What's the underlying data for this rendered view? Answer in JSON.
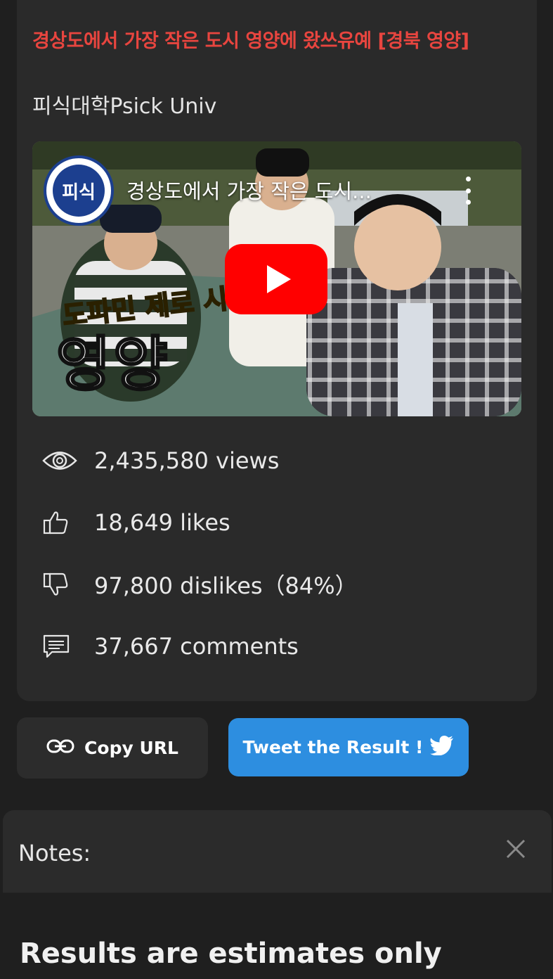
{
  "video": {
    "title": "경상도에서 가장 작은 도시 영양에 왔쓰유예 [경북 영양]",
    "channel": "피식대학Psick Univ",
    "thumbnail": {
      "overlay_title": "경상도에서 가장 작은 도시...",
      "channel_logo_text": "피식",
      "caption_small": "도파민 제로 시",
      "caption_big": "영양"
    }
  },
  "stats": {
    "views": "2,435,580 views",
    "likes": "18,649 likes",
    "dislikes": "97,800 dislikes（84%）",
    "comments": "37,667 comments"
  },
  "actions": {
    "copy_url": "Copy URL",
    "tweet": "Tweet the Result !"
  },
  "notes": {
    "label": "Notes:",
    "heading": "Results are estimates only"
  },
  "colors": {
    "title_red": "#e8453f",
    "tweet_blue": "#2d8ee0",
    "youtube_red": "#ff0000"
  }
}
